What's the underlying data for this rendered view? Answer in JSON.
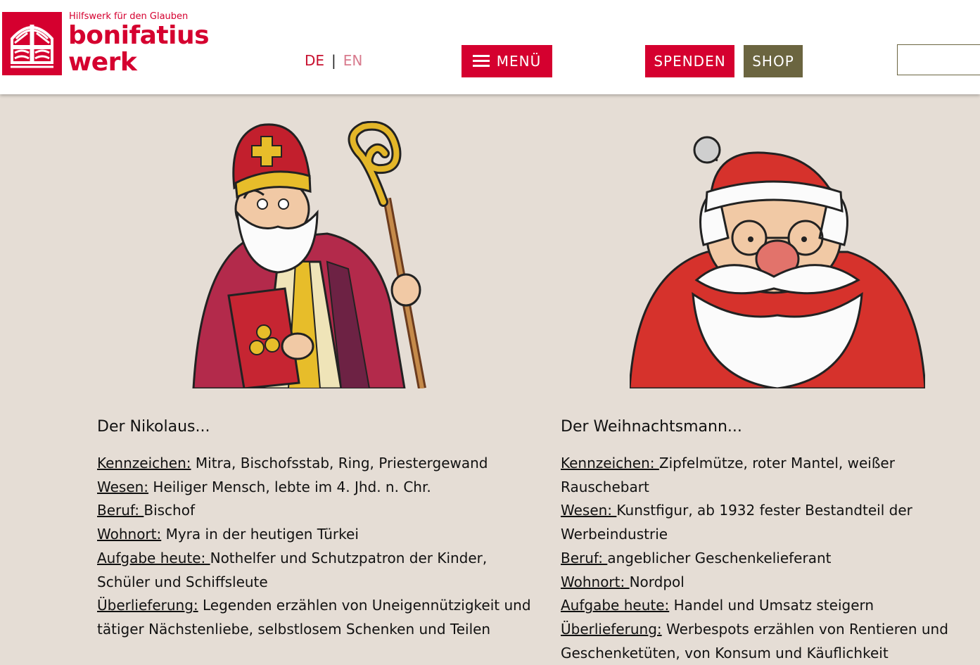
{
  "header": {
    "logo": {
      "tagline": "Hilfswerk für den Glauben",
      "name_line1": "bonifatius",
      "name_line2": "werk",
      "brand_color": "#d5002f"
    },
    "lang": {
      "de": "DE",
      "separator": "|",
      "en": "EN"
    },
    "menu_label": "MENÜ",
    "donate_label": "SPENDEN",
    "shop_label": "SHOP",
    "search_value": "",
    "accent_olive": "#6b6540"
  },
  "background_color": "#e5ddd5",
  "nikolaus": {
    "title": "Der Nikolaus...",
    "items": [
      {
        "label": "Kennzeichen:",
        "text": " Mitra, Bischofsstab, Ring, Priestergewand"
      },
      {
        "label": "Wesen:",
        "text": " Heiliger Mensch, lebte im 4. Jhd. n. Chr."
      },
      {
        "label": "Beruf: ",
        "text": "Bischof"
      },
      {
        "label": "Wohnort:",
        "text": " Myra in der heutigen Türkei"
      },
      {
        "label": "Aufgabe heute: ",
        "text": "Nothelfer und Schutzpatron der Kinder, Schüler und Schiffsleute"
      },
      {
        "label": "Überlieferung:",
        "text": " Legenden erzählen von Uneigennützigkeit und tätiger Nächstenliebe, selbstlosem Schenken und Teilen"
      }
    ]
  },
  "weihnachtsmann": {
    "title": "Der Weihnachtsmann...",
    "items": [
      {
        "label": "Kennzeichen: ",
        "text": "Zipfelmütze, roter Mantel, weißer Rauschebart"
      },
      {
        "label": "Wesen: ",
        "text": "Kunstfigur, ab 1932 fester Bestandteil der Werbeindustrie"
      },
      {
        "label": "Beruf: ",
        "text": "angeblicher Geschenkelieferant"
      },
      {
        "label": "Wohnort: ",
        "text": "Nordpol"
      },
      {
        "label": "Aufgabe heute:",
        "text": " Handel und Umsatz steigern"
      },
      {
        "label": "Überlieferung:",
        "text": " Werbespots erzählen von Rentieren und Geschenketüten, von Konsum und Käuflichkeit"
      }
    ]
  }
}
